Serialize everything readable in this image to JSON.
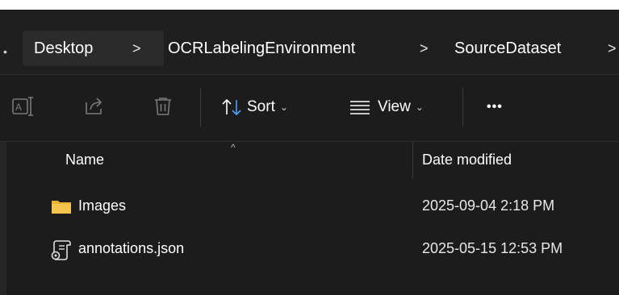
{
  "breadcrumb": {
    "items": [
      {
        "label": "Desktop"
      },
      {
        "label": "OCRLabelingEnvironment"
      },
      {
        "label": "SourceDataset"
      }
    ],
    "separator": ">"
  },
  "toolbar": {
    "sort_label": "Sort",
    "view_label": "View",
    "more_label": "•••",
    "chevron_down": "⌄",
    "icons": [
      "rename-icon",
      "share-icon",
      "delete-icon",
      "sort-icon",
      "view-icon",
      "more-icon"
    ]
  },
  "columns": {
    "name_header": "Name",
    "date_header": "Date modified",
    "sort_indicator": "^"
  },
  "files": [
    {
      "name": "Images",
      "date": "2025-09-04 2:18 PM",
      "icon": "folder-icon"
    },
    {
      "name": "annotations.json",
      "date": "2025-05-15 12:53 PM",
      "icon": "json-file-icon"
    }
  ],
  "colors": {
    "background": "#1c1c1c",
    "folder": "#f4c44e",
    "accent": "#4ea0f5"
  }
}
